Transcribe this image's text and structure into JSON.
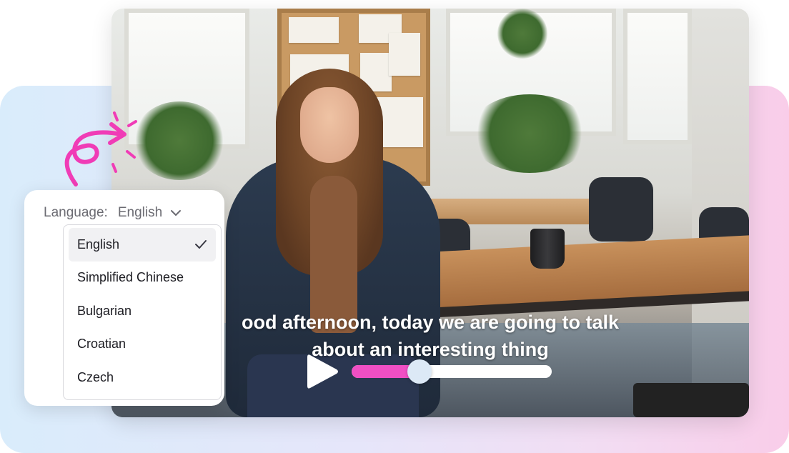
{
  "video": {
    "caption_line1": "ood afternoon, today we are going to talk",
    "caption_line2": "about an interesting thing",
    "progress": 0.34,
    "accent_color": "#f04fc4"
  },
  "language_selector": {
    "label": "Language:",
    "selected": "English",
    "options": [
      {
        "label": "English",
        "selected": true
      },
      {
        "label": "Simplified Chinese",
        "selected": false
      },
      {
        "label": "Bulgarian",
        "selected": false
      },
      {
        "label": "Croatian",
        "selected": false
      },
      {
        "label": "Czech",
        "selected": false
      }
    ]
  },
  "icons": {
    "play": "play-icon",
    "chevron": "chevron-down-icon",
    "check": "check-icon",
    "arrow": "curved-arrow-icon"
  }
}
